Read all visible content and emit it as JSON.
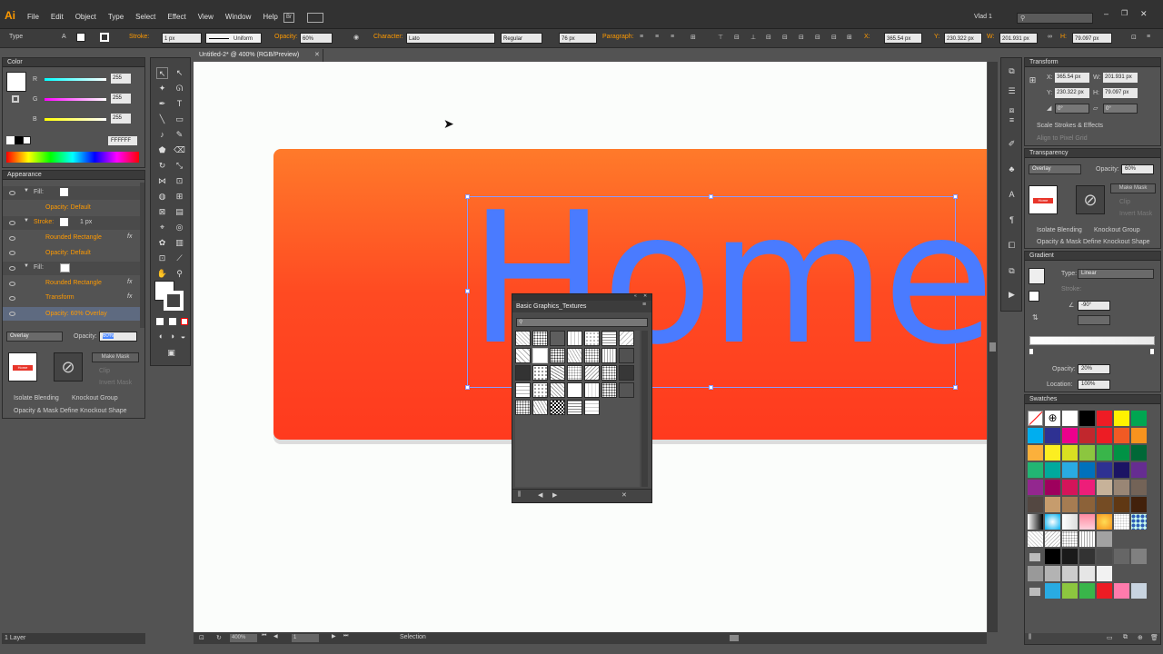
{
  "app": {
    "logo": "Ai",
    "user": "Vlad 1",
    "menu": [
      "File",
      "Edit",
      "Object",
      "Type",
      "Select",
      "Effect",
      "View",
      "Window",
      "Help"
    ],
    "br": "Br"
  },
  "control": {
    "mode": "Type",
    "stroke_label": "Stroke:",
    "stroke_value": "1 px",
    "stroke_style": "Uniform",
    "opacity_label": "Opacity:",
    "opacity_value": "60%",
    "character_label": "Character:",
    "font": "Lato",
    "weight": "Regular",
    "size": "76 px",
    "paragraph_label": "Paragraph:",
    "x_label": "X:",
    "x_value": "365.54 px",
    "y_label": "Y:",
    "y_value": "230.322 px",
    "w_label": "W:",
    "w_value": "201.931 px",
    "h_label": "H:",
    "h_value": "79.097 px"
  },
  "doc": {
    "tab": "Untitled-2* @ 400% (RGB/Preview)",
    "text": "Home",
    "zoom": "400%",
    "page": "1",
    "status": "Selection"
  },
  "color": {
    "title": "Color",
    "r": "255",
    "g": "255",
    "b": "255",
    "hex": "FFFFFF"
  },
  "appearance": {
    "title": "Appearance",
    "fill": "Fill:",
    "opacity_default": "Opacity: Default",
    "stroke": "Stroke:",
    "stroke_px": "1 px",
    "rounded": "Rounded Rectangle",
    "transform": "Transform",
    "opacity_overlay": "Opacity: 60% Overlay",
    "fx": "fx"
  },
  "transp_left": {
    "blend": "Overlay",
    "opacity_label": "Opacity:",
    "opacity_value": "60%",
    "make_mask": "Make Mask",
    "clip": "Clip",
    "invert": "Invert Mask",
    "isolate": "Isolate Blending",
    "knockout": "Knockout Group",
    "define": "Opacity & Mask Define Knockout Shape",
    "thumb": "Home"
  },
  "layers": {
    "count": "1 Layer"
  },
  "textures": {
    "title": "Basic Graphics_Textures"
  },
  "transform": {
    "title": "Transform",
    "x_label": "X:",
    "x_value": "365.54 px",
    "y_label": "Y:",
    "y_value": "230.322 px",
    "w_label": "W:",
    "w_value": "201.931 px",
    "h_label": "H:",
    "h_value": "79.097 px",
    "angle": "0°",
    "shear": "0°",
    "scale_strokes": "Scale Strokes & Effects",
    "align_pixel": "Align to Pixel Grid"
  },
  "transparency": {
    "title": "Transparency",
    "blend": "Overlay",
    "opacity_label": "Opacity:",
    "opacity_value": "60%",
    "make_mask": "Make Mask",
    "clip": "Clip",
    "invert": "Invert Mask",
    "isolate": "Isolate Blending",
    "knockout": "Knockout Group",
    "define": "Opacity & Mask Define Knockout Shape",
    "thumb": "Home"
  },
  "gradient": {
    "title": "Gradient",
    "type_label": "Type:",
    "type_value": "Linear",
    "stroke_label": "Stroke:",
    "angle": "-90°",
    "opacity_label": "Opacity:",
    "opacity_value": "20%",
    "location_label": "Location:",
    "location_value": "100%"
  },
  "swatches": {
    "title": "Swatches"
  },
  "colors": {
    "accent": "#ff9a00",
    "text_blue": "#4a7bff",
    "button_top": "#ff7a2a",
    "button_bottom": "#ff3a1e"
  }
}
